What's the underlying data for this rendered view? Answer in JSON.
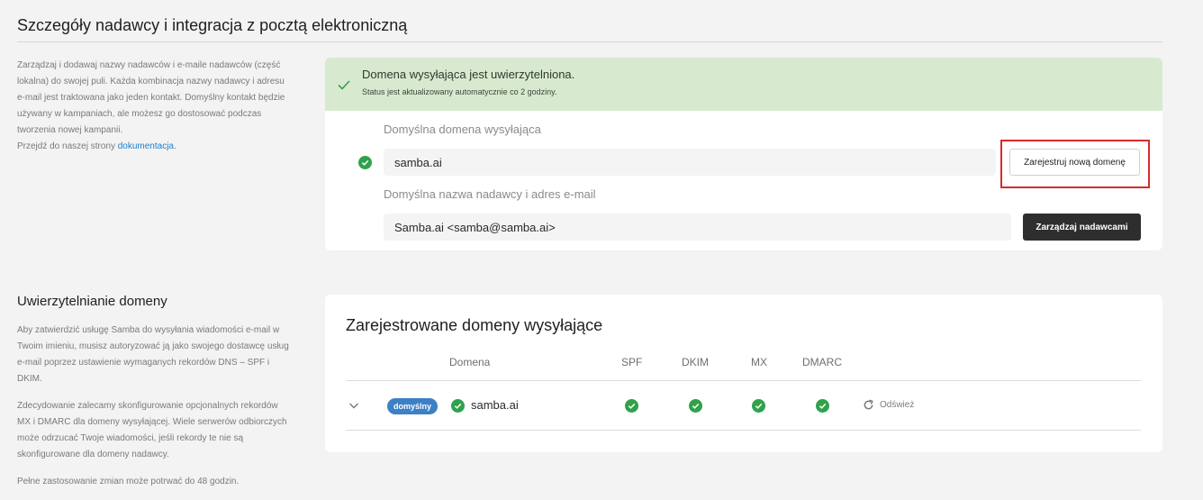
{
  "sender": {
    "title": "Szczegóły nadawcy i integracja z pocztą elektroniczną",
    "description_lines": [
      "Zarządzaj i dodawaj nazwy nadawców i e-maile nadawców (część",
      "lokalna) do swojej puli. Każda kombinacja nazwy nadawcy i adresu",
      "e-mail jest traktowana jako jeden kontakt. Domyślny kontakt będzie",
      "używany w kampaniach, ale możesz go dostosować podczas",
      "tworzenia nowej kampanii."
    ],
    "docs_prefix": "Przejdź do naszej strony ",
    "docs_link": "dokumentacja",
    "docs_suffix": ".",
    "banner_title": "Domena wysyłająca jest uwierzytelniona.",
    "banner_subtitle": "Status jest aktualizowany automatycznie co 2 godziny.",
    "default_domain_label": "Domyślna domena wysyłająca",
    "default_domain_value": "samba.ai",
    "register_domain_button": "Zarejestruj nową domenę",
    "default_sender_label": "Domyślna nazwa nadawcy i adres e-mail",
    "default_sender_value": "Samba.ai <samba@samba.ai>",
    "manage_senders_button": "Zarządzaj nadawcami"
  },
  "auth": {
    "title": "Uwierzytelnianie domeny",
    "para1_lines": [
      "Aby zatwierdzić usługę Samba do wysyłania wiadomości e-mail w",
      "Twoim imieniu, musisz autoryzować ją jako swojego dostawcę usług",
      "e-mail poprzez ustawienie wymaganych rekordów DNS – SPF i",
      "DKIM."
    ],
    "para2_lines": [
      "Zdecydowanie zalecamy skonfigurowanie opcjonalnych rekordów",
      "MX i DMARC dla domeny wysyłającej. Wiele serwerów odbiorczych",
      "może odrzucać Twoje wiadomości, jeśli rekordy te nie są",
      "skonfigurowane dla domeny nadawcy."
    ],
    "para3": "Pełne zastosowanie zmian może potrwać do 48 godzin.",
    "table_title": "Zarejestrowane domeny wysyłające",
    "columns": {
      "domain": "Domena",
      "spf": "SPF",
      "dkim": "DKIM",
      "mx": "MX",
      "dmarc": "DMARC"
    },
    "row": {
      "badge": "domyślny",
      "domain": "samba.ai",
      "refresh": "Odśwież"
    }
  },
  "colors": {
    "accent": "#1c7fd1",
    "success": "#2fa24b",
    "banner": "#d7ead0",
    "highlight": "#d92b2b",
    "badge": "#3d80c5"
  }
}
